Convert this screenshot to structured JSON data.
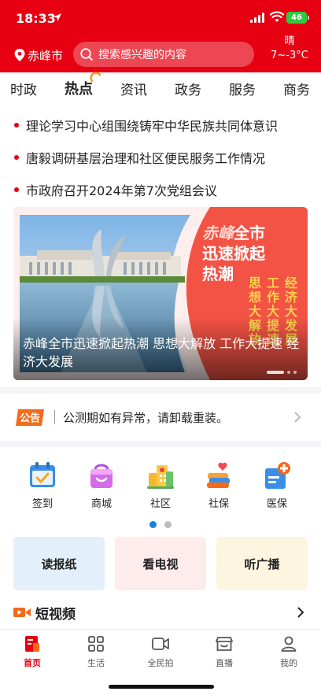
{
  "status_bar": {
    "time": "18:33",
    "battery": "46"
  },
  "header": {
    "city": "赤峰市",
    "search_placeholder": "搜索感兴趣的内容",
    "weather": {
      "condition": "晴",
      "temperature": "7~-3°C"
    }
  },
  "tabs": [
    {
      "label": "时政"
    },
    {
      "label": "热点",
      "active": true
    },
    {
      "label": "资讯"
    },
    {
      "label": "政务"
    },
    {
      "label": "服务"
    },
    {
      "label": "商务"
    }
  ],
  "headlines": [
    "理论学习中心组围绕铸牢中华民族共同体意识",
    "唐毅调研基层治理和社区便民服务工作情况",
    "市政府召开2024年第7次党组会议"
  ],
  "banner": {
    "caption": "赤峰全市迅速掀起热潮 思想大解放 工作大提速 经济大发展",
    "art_title_prefix": "赤峰",
    "art_title_rest_line1": "全市",
    "art_title_line2": "迅速掀起",
    "art_title_line3": "热潮",
    "art_columns": [
      "经济大发展",
      "工作大提速",
      "思想大解放"
    ]
  },
  "notice": {
    "badge": "公告",
    "text": "公测期如有异常，请卸载重装。"
  },
  "services": [
    {
      "label": "签到",
      "icon": "calendar-check-icon"
    },
    {
      "label": "商城",
      "icon": "shopping-bag-icon"
    },
    {
      "label": "社区",
      "icon": "community-building-icon"
    },
    {
      "label": "社保",
      "icon": "social-security-icon"
    },
    {
      "label": "医保",
      "icon": "medical-insurance-icon"
    }
  ],
  "media_cards": [
    "读报纸",
    "看电视",
    "听广播"
  ],
  "short_video": {
    "title": "短视频"
  },
  "bottom_nav": [
    {
      "label": "首页",
      "active": true
    },
    {
      "label": "生活"
    },
    {
      "label": "全民拍"
    },
    {
      "label": "直播"
    },
    {
      "label": "我的"
    }
  ],
  "colors": {
    "brand_red": "#e60012",
    "active_dot": "#1a7fe8",
    "battery_green": "#2ecc40"
  }
}
